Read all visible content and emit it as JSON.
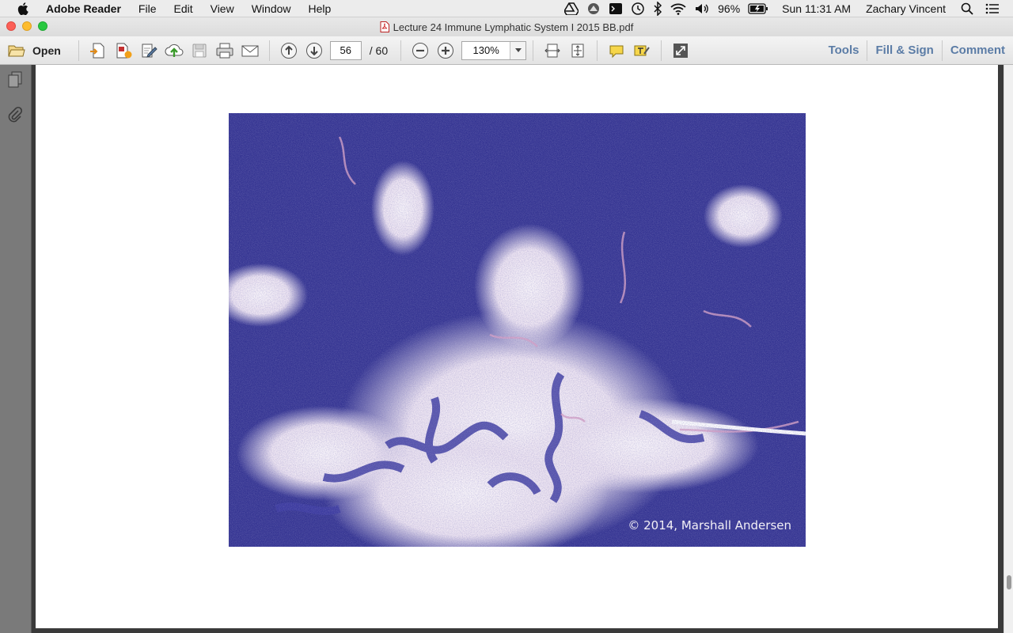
{
  "menubar": {
    "app_name": "Adobe Reader",
    "menus": [
      "File",
      "Edit",
      "View",
      "Window",
      "Help"
    ],
    "battery": "96%",
    "clock": "Sun 11:31 AM",
    "user": "Zachary Vincent"
  },
  "window": {
    "title": "Lecture 24 Immune Lymphatic System I 2015 BB.pdf"
  },
  "toolbar": {
    "open_label": "Open",
    "current_page": "56",
    "total_pages": "/ 60",
    "zoom": "130%",
    "links": [
      "Tools",
      "Fill & Sign",
      "Comment"
    ]
  },
  "document": {
    "image_credit": "© 2014, Marshall Andersen"
  },
  "colors": {
    "accent": "#5b7ca6",
    "stain_purple": "#3b3a9c",
    "stain_pink": "#d9a3c6"
  }
}
